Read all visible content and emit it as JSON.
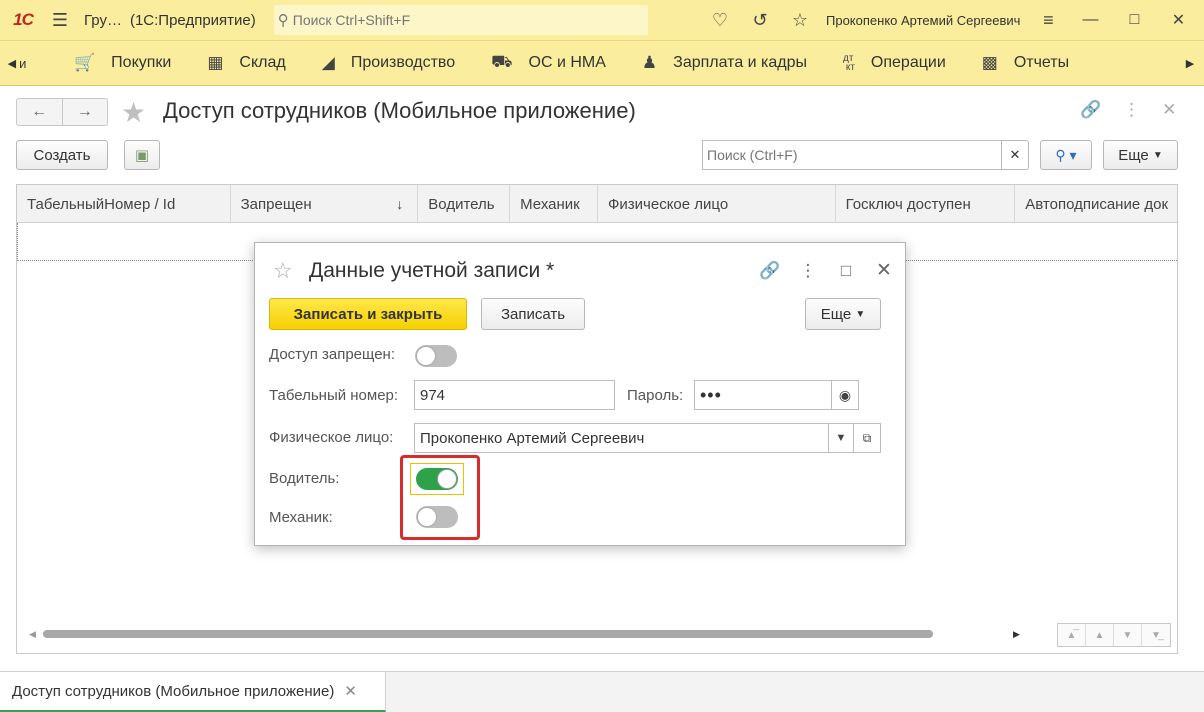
{
  "titlebar": {
    "logo": "1С",
    "app_short": "Гру…",
    "app_name": "(1С:Предприятие)",
    "search_placeholder": "Поиск Ctrl+Shift+F",
    "user": "Прокопенко Артемий Сергеевич"
  },
  "sections": [
    {
      "label": "Покупки",
      "icon": "cart-icon"
    },
    {
      "label": "Склад",
      "icon": "warehouse-icon"
    },
    {
      "label": "Производство",
      "icon": "factory-icon"
    },
    {
      "label": "ОС и НМА",
      "icon": "truck-icon"
    },
    {
      "label": "Зарплата и кадры",
      "icon": "person-icon"
    },
    {
      "label": "Операции",
      "icon": "dt-kt-icon"
    },
    {
      "label": "Отчеты",
      "icon": "bar-chart-icon"
    }
  ],
  "form": {
    "title": "Доступ сотрудников (Мобильное приложение)",
    "create_label": "Создать",
    "search_placeholder": "Поиск (Ctrl+F)",
    "more_label": "Еще"
  },
  "table": {
    "columns": [
      {
        "label": "ТабельныйНомер / Id",
        "width": 214
      },
      {
        "label": "Запрещен",
        "width": 188,
        "sort": "↓"
      },
      {
        "label": "Водитель",
        "width": 92
      },
      {
        "label": "Механик",
        "width": 88
      },
      {
        "label": "Физическое лицо",
        "width": 238
      },
      {
        "label": "Госключ доступен",
        "width": 180
      },
      {
        "label": "Автоподписание док",
        "width": 162
      }
    ]
  },
  "bottom_tab": {
    "label": "Доступ сотрудников (Мобильное приложение)"
  },
  "dialog": {
    "title": "Данные учетной записи *",
    "save_close_label": "Записать и закрыть",
    "save_label": "Записать",
    "more_label": "Еще",
    "access_denied_label": "Доступ запрещен:",
    "access_denied": false,
    "tab_number_label": "Табельный номер:",
    "tab_number": "974",
    "password_label": "Пароль:",
    "password": "•••",
    "person_label": "Физическое лицо:",
    "person": "Прокопенко Артемий Сергеевич",
    "driver_label": "Водитель:",
    "driver": true,
    "mechanic_label": "Механик:",
    "mechanic": false
  },
  "colors": {
    "accent_yellow": "#fbed9e",
    "primary_button": "#f5d000",
    "toggle_on": "#2ea24b",
    "highlight_red": "#d82b2b"
  }
}
